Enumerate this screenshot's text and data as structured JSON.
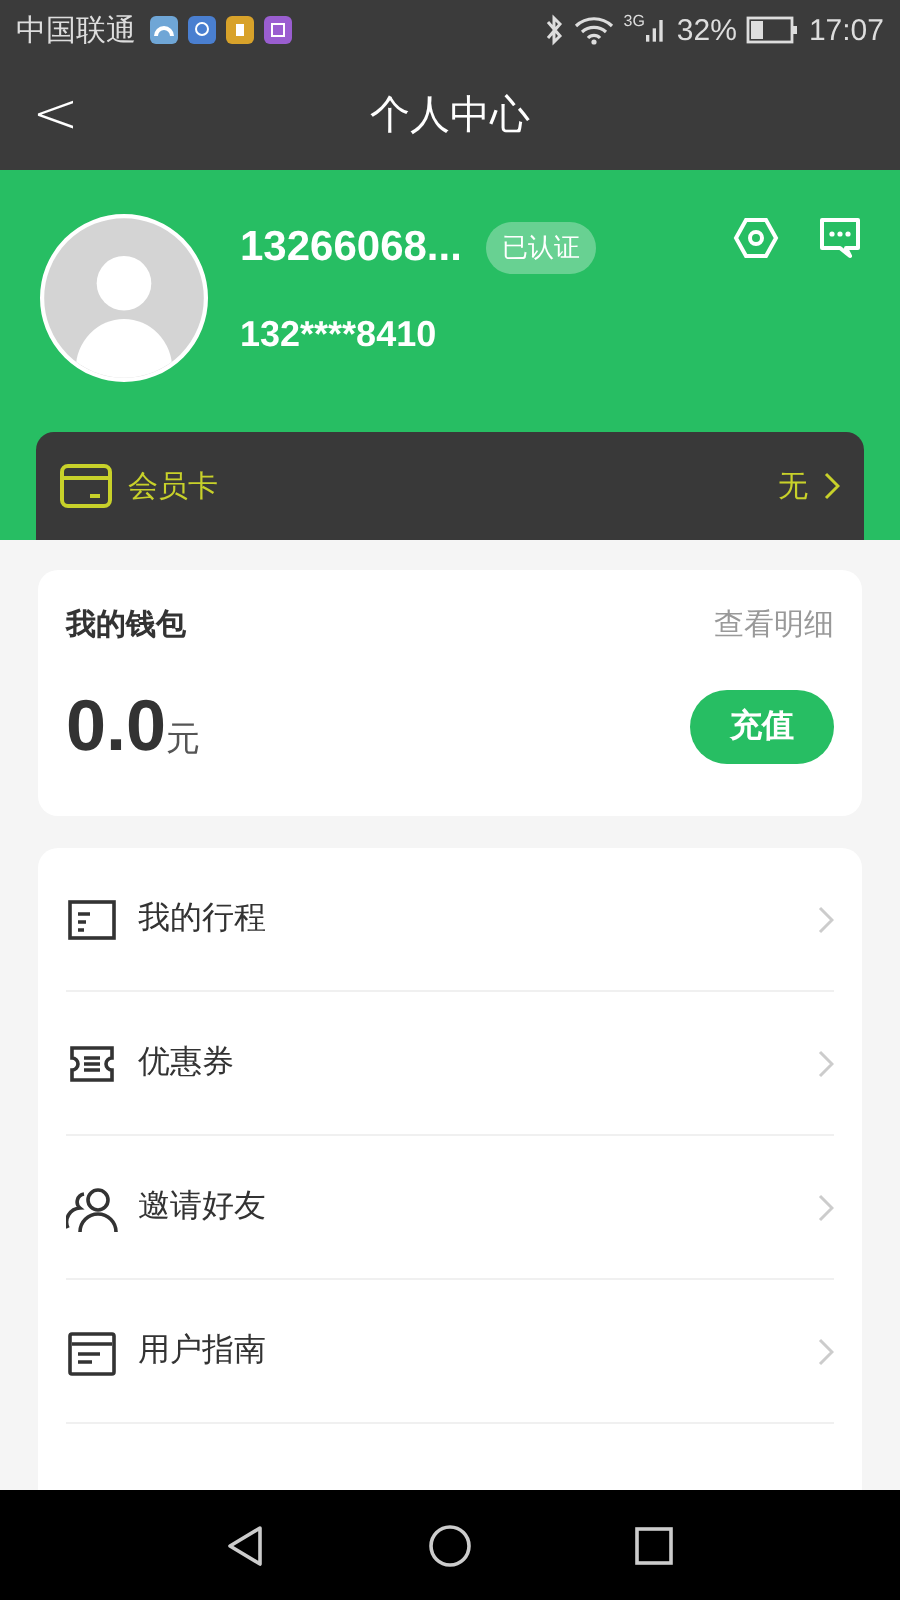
{
  "status_bar": {
    "carrier": "中国联通",
    "network": "3G",
    "battery": "32%",
    "time": "17:07"
  },
  "header": {
    "back": "<",
    "title": "个人中心"
  },
  "profile": {
    "name": "13266068...",
    "badge": "已认证",
    "phone": "132****8410"
  },
  "member_card": {
    "label": "会员卡",
    "value": "无"
  },
  "wallet": {
    "title": "我的钱包",
    "link": "查看明细",
    "amount": "0.0",
    "unit": "元",
    "button": "充值"
  },
  "menu": [
    {
      "kind": "trip",
      "label": "我的行程"
    },
    {
      "kind": "coupon",
      "label": "优惠券"
    },
    {
      "kind": "invite",
      "label": "邀请好友"
    },
    {
      "kind": "guide",
      "label": "用户指南"
    }
  ]
}
